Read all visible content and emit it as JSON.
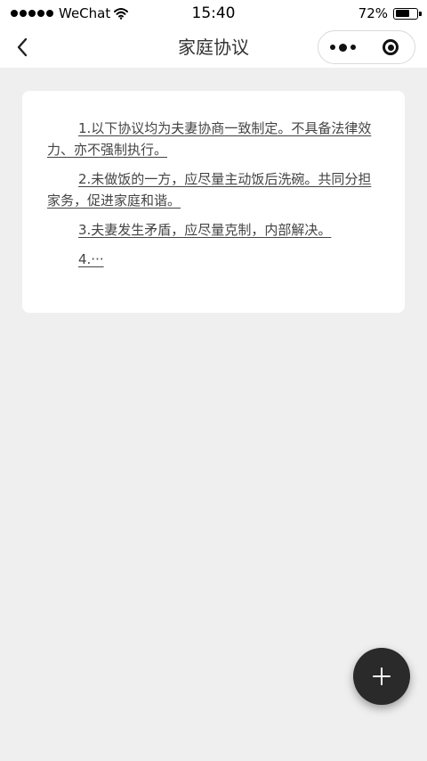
{
  "status_bar": {
    "carrier": "WeChat",
    "time": "15:40",
    "battery": "72%",
    "battery_level": 0.72,
    "icons": [
      "signal-dots-icon",
      "wifi-icon",
      "battery-icon"
    ]
  },
  "nav": {
    "title": "家庭协议",
    "back_icon": "chevron-left-icon",
    "capsule_icons": [
      "more-dots-icon",
      "target-close-icon"
    ]
  },
  "agreement": {
    "clauses": [
      "1.以下协议均为夫妻协商一致制定。不具备法律效力、亦不强制执行。",
      "2.未做饭的一方，应尽量主动饭后洗碗。共同分担家务，促进家庭和谐。",
      "3.夫妻发生矛盾，应尽量克制，内部解决。",
      "4.···"
    ]
  },
  "fab": {
    "icon": "plus-icon"
  },
  "colors": {
    "page_background": "#efefef",
    "card_background": "#ffffff",
    "fab_background": "#2a2a2a",
    "text": "#444444"
  }
}
